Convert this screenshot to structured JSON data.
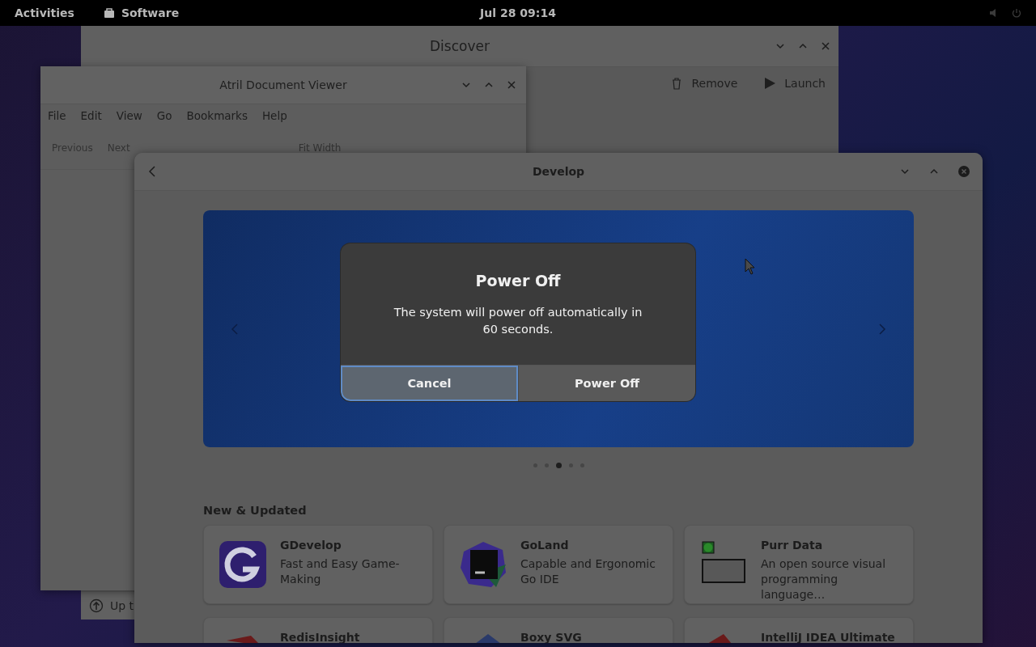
{
  "top_bar": {
    "activities": "Activities",
    "app": "Software",
    "clock": "Jul 28  09:14"
  },
  "discover_window": {
    "title": "Discover",
    "actions": [
      "Remove",
      "Launch"
    ],
    "status": "Up t"
  },
  "atril_window": {
    "title": "Atril Document Viewer",
    "menu": [
      "File",
      "Edit",
      "View",
      "Go",
      "Bookmarks",
      "Help"
    ],
    "toolbar": [
      "Previous",
      "Next",
      "Fit Width"
    ]
  },
  "develop_window": {
    "title": "Develop",
    "carousel_dots": [
      {
        "selected": false
      },
      {
        "selected": false
      },
      {
        "selected": true
      },
      {
        "selected": false
      },
      {
        "selected": false
      }
    ],
    "section_title": "New & Updated",
    "apps": [
      {
        "name": "GDevelop",
        "summary": "Fast and Easy Game-Making"
      },
      {
        "name": "GoLand",
        "summary": "Capable and Ergonomic Go IDE"
      },
      {
        "name": "Purr Data",
        "summary": "An open source visual programming language…"
      },
      {
        "name": "RedisInsight"
      },
      {
        "name": "Boxy SVG"
      },
      {
        "name": "IntelliJ IDEA Ultimate"
      }
    ]
  },
  "dialog": {
    "title": "Power Off",
    "message": "The system will power off automatically in 60 seconds.",
    "buttons": [
      {
        "label": "Cancel",
        "selected": true
      },
      {
        "label": "Power Off",
        "selected": false
      }
    ]
  }
}
